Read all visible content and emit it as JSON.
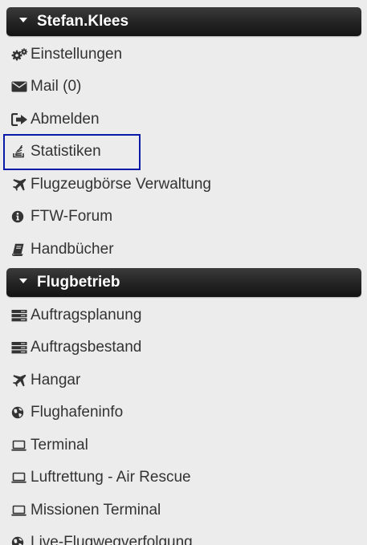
{
  "sections": [
    {
      "title": "Stefan.Klees",
      "items": [
        {
          "label": "Einstellungen",
          "icon": "gears-icon"
        },
        {
          "label": "Mail (0)",
          "icon": "envelope-icon"
        },
        {
          "label": "Abmelden",
          "icon": "sign-out-icon"
        },
        {
          "label": "Statistiken",
          "icon": "stack-icon"
        },
        {
          "label": "Flugzeugbörse Verwaltung",
          "icon": "plane-icon"
        },
        {
          "label": "FTW-Forum",
          "icon": "info-icon"
        },
        {
          "label": "Handbücher",
          "icon": "book-icon"
        }
      ]
    },
    {
      "title": "Flugbetrieb",
      "items": [
        {
          "label": "Auftragsplanung",
          "icon": "server-icon"
        },
        {
          "label": "Auftragsbestand",
          "icon": "server-icon"
        },
        {
          "label": "Hangar",
          "icon": "plane-icon"
        },
        {
          "label": "Flughafeninfo",
          "icon": "globe-icon"
        },
        {
          "label": "Terminal",
          "icon": "laptop-icon"
        },
        {
          "label": "Luftrettung - Air Rescue",
          "icon": "laptop-icon"
        },
        {
          "label": "Missionen Terminal",
          "icon": "laptop-icon"
        },
        {
          "label": "Live-Flugwegverfolgung",
          "icon": "globe-icon"
        }
      ]
    }
  ],
  "colors": {
    "header_background": "#232323",
    "header_text": "#ffffff",
    "item_text": "#333333",
    "page_background": "#ececec",
    "focus_outline": "#0a1aa8"
  }
}
